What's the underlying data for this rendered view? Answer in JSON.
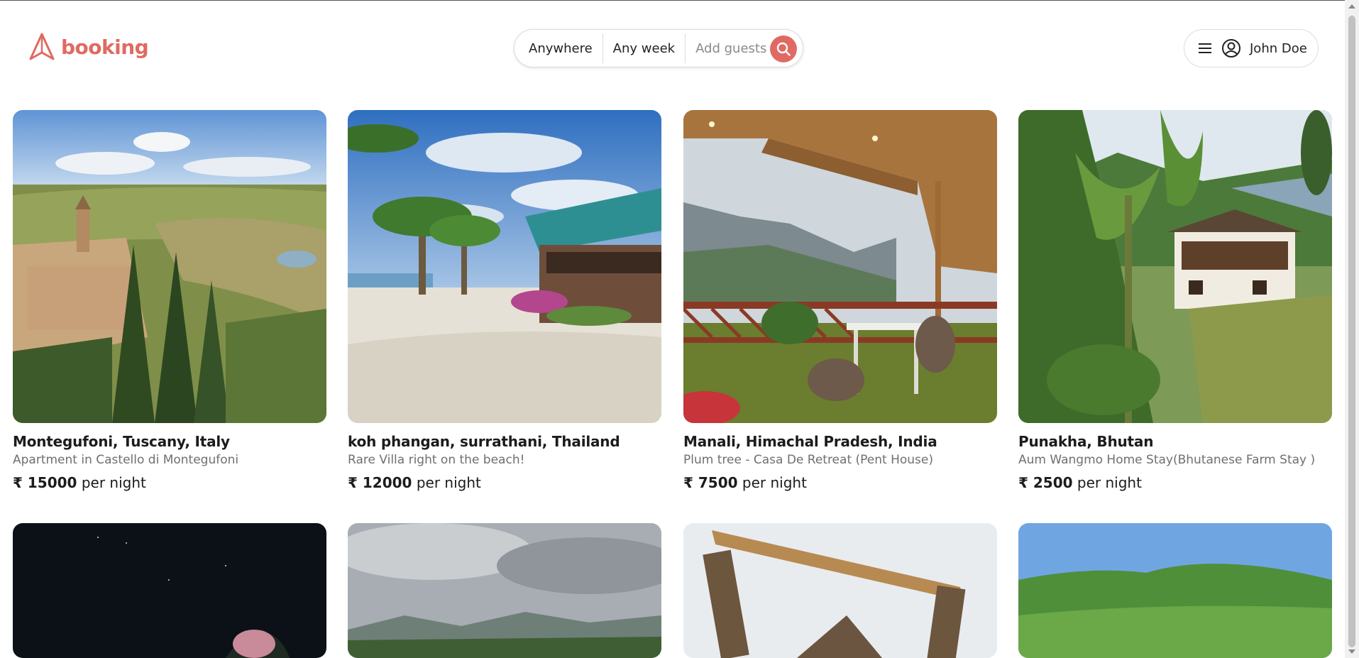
{
  "header": {
    "logo_text": "booking",
    "search": {
      "location": "Anywhere",
      "week": "Any week",
      "guests_placeholder": "Add guests"
    },
    "user": {
      "name": "John Doe"
    }
  },
  "colors": {
    "brand": "#e06a63",
    "text": "#222222",
    "muted": "#6f6f6f",
    "border": "#dddddd"
  },
  "listings": [
    {
      "title": "Montegufoni, Tuscany, Italy",
      "subtitle": "Apartment in Castello di Montegufoni",
      "currency": "₹",
      "amount": "15000",
      "unit": "per night"
    },
    {
      "title": "koh phangan, surrathani, Thailand",
      "subtitle": "Rare Villa right on the beach!",
      "currency": "₹",
      "amount": "12000",
      "unit": "per night"
    },
    {
      "title": "Manali, Himachal Pradesh, India",
      "subtitle": "Plum tree - Casa De Retreat (Pent House)",
      "currency": "₹",
      "amount": "7500",
      "unit": "per night"
    },
    {
      "title": "Punakha, Bhutan",
      "subtitle": "Aum Wangmo Home Stay(Bhutanese Farm Stay )",
      "currency": "₹",
      "amount": "2500",
      "unit": "per night"
    }
  ],
  "listing_rows_partial": [
    {
      "title": ""
    },
    {
      "title": ""
    },
    {
      "title": ""
    },
    {
      "title": ""
    }
  ]
}
